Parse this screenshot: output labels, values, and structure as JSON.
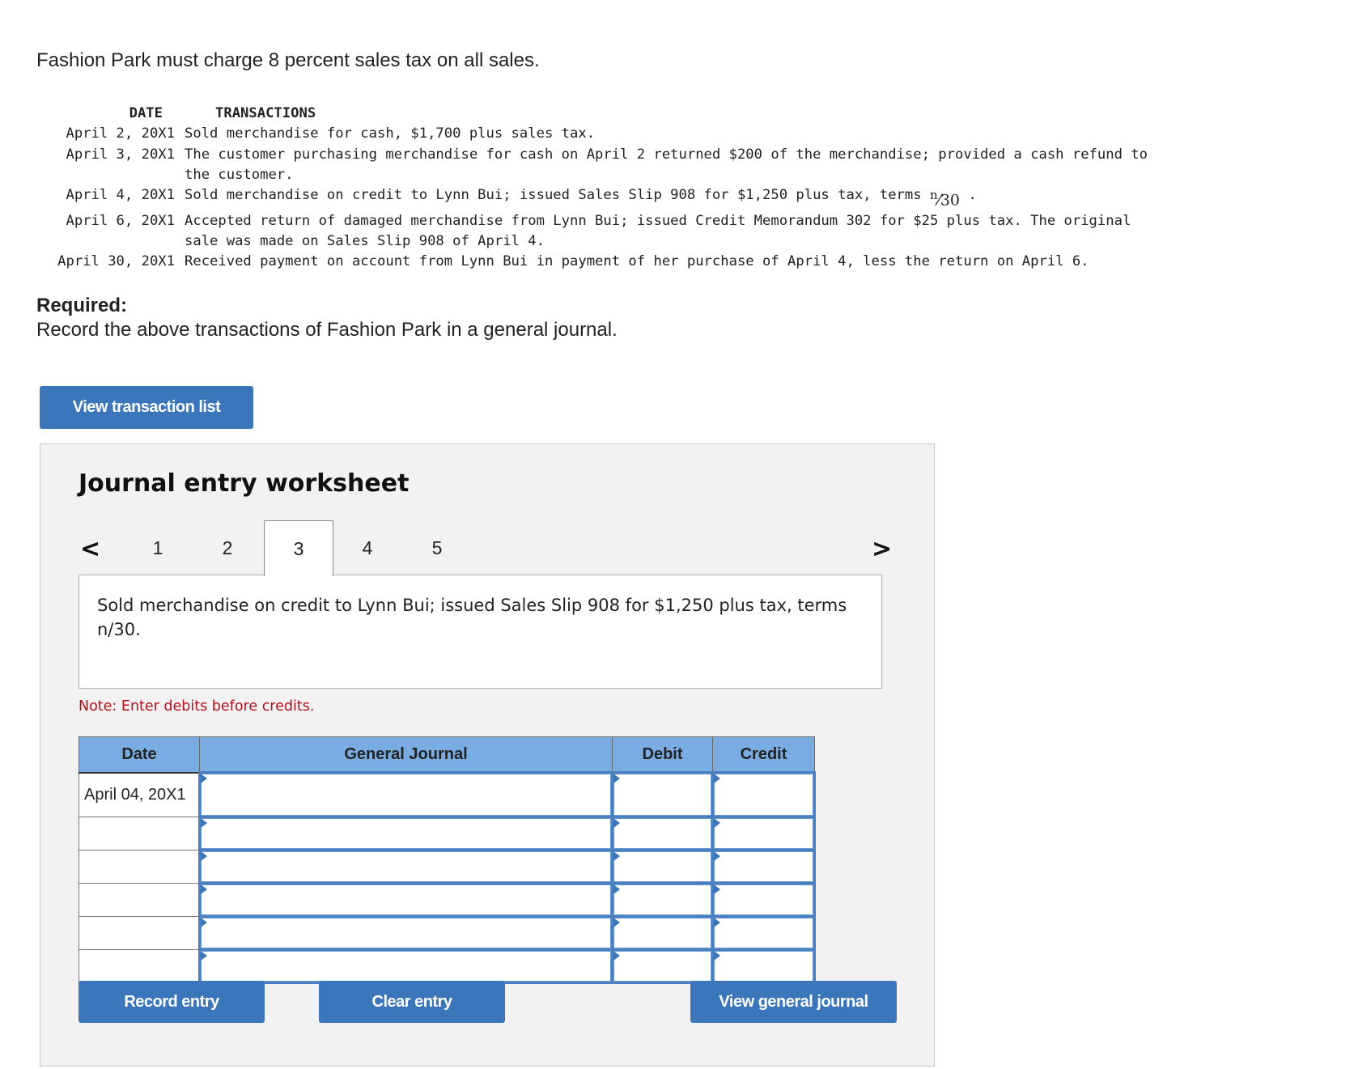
{
  "intro": "Fashion Park must charge 8 percent sales tax on all sales.",
  "transactions": {
    "header_date": "DATE",
    "header_transactions": "TRANSACTIONS",
    "rows": [
      {
        "date": "April 2, 20X1",
        "lines": [
          "Sold merchandise for cash, $1,700 plus sales tax."
        ]
      },
      {
        "date": "April 3, 20X1",
        "lines": [
          "The customer purchasing merchandise for cash on April 2 returned $200 of the merchandise; provided a cash refund to",
          "the customer."
        ]
      },
      {
        "date": "April 4, 20X1",
        "lines": [
          "Sold merchandise on credit to Lynn Bui; issued Sales Slip 908 for $1,250 plus tax, terms "
        ],
        "terms_num": "n",
        "terms_den": "30",
        "terms_suffix": " ."
      },
      {
        "date": "April 6, 20X1",
        "lines": [
          "Accepted return of damaged merchandise from Lynn Bui; issued Credit Memorandum 302 for $25 plus tax. The original",
          "sale was made on Sales Slip 908 of April 4."
        ]
      },
      {
        "date": "April 30, 20X1",
        "lines": [
          "Received payment on account from Lynn Bui in payment of her purchase of April 4, less the return on April 6."
        ]
      }
    ]
  },
  "required": {
    "title": "Required:",
    "text": "Record the above transactions of Fashion Park in a general journal."
  },
  "view_transaction_list": "View transaction list",
  "worksheet": {
    "title": "Journal entry worksheet",
    "prev_icon": "<",
    "next_icon": ">",
    "tabs": [
      "1",
      "2",
      "3",
      "4",
      "5"
    ],
    "active_tab": "3",
    "description": "Sold merchandise on credit to Lynn Bui; issued Sales Slip 908 for $1,250 plus tax, terms n/30.",
    "note": "Note: Enter debits before credits.",
    "table": {
      "headers": [
        "Date",
        "General Journal",
        "Debit",
        "Credit"
      ],
      "rows": [
        {
          "date": "April 04, 20X1",
          "account": "",
          "debit": "",
          "credit": ""
        },
        {
          "date": "",
          "account": "",
          "debit": "",
          "credit": ""
        },
        {
          "date": "",
          "account": "",
          "debit": "",
          "credit": ""
        },
        {
          "date": "",
          "account": "",
          "debit": "",
          "credit": ""
        },
        {
          "date": "",
          "account": "",
          "debit": "",
          "credit": ""
        },
        {
          "date": "",
          "account": "",
          "debit": "",
          "credit": ""
        }
      ]
    },
    "buttons": {
      "record": "Record entry",
      "clear": "Clear entry",
      "view_journal": "View general journal"
    }
  },
  "colors": {
    "button_blue": "#3a76b9",
    "header_blue": "#78ace3",
    "note_red": "#b2121a",
    "panel_bg": "#f2f2f2"
  }
}
